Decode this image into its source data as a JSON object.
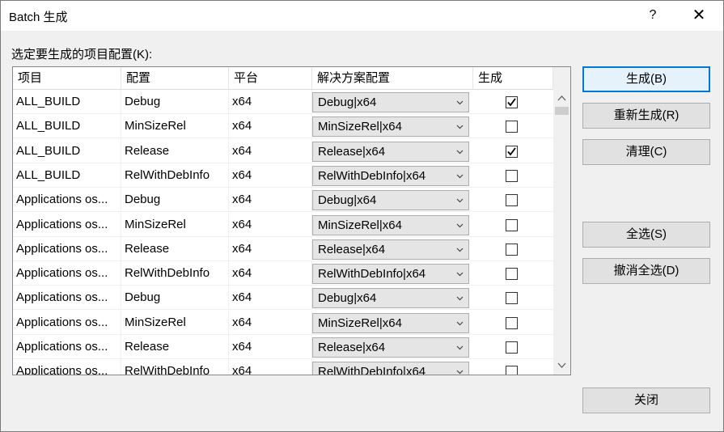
{
  "window": {
    "title": "Batch 生成",
    "help_glyph": "?",
    "close_glyph": "✕"
  },
  "prompt_label": "选定要生成的项目配置(K):",
  "columns": [
    "项目",
    "配置",
    "平台",
    "解决方案配置",
    "生成"
  ],
  "rows": [
    {
      "project": "ALL_BUILD",
      "config": "Debug",
      "platform": "x64",
      "solution_config": "Debug|x64",
      "build": true
    },
    {
      "project": "ALL_BUILD",
      "config": "MinSizeRel",
      "platform": "x64",
      "solution_config": "MinSizeRel|x64",
      "build": false
    },
    {
      "project": "ALL_BUILD",
      "config": "Release",
      "platform": "x64",
      "solution_config": "Release|x64",
      "build": true
    },
    {
      "project": "ALL_BUILD",
      "config": "RelWithDebInfo",
      "platform": "x64",
      "solution_config": "RelWithDebInfo|x64",
      "build": false
    },
    {
      "project": "Applications os...",
      "config": "Debug",
      "platform": "x64",
      "solution_config": "Debug|x64",
      "build": false
    },
    {
      "project": "Applications os...",
      "config": "MinSizeRel",
      "platform": "x64",
      "solution_config": "MinSizeRel|x64",
      "build": false
    },
    {
      "project": "Applications os...",
      "config": "Release",
      "platform": "x64",
      "solution_config": "Release|x64",
      "build": false
    },
    {
      "project": "Applications os...",
      "config": "RelWithDebInfo",
      "platform": "x64",
      "solution_config": "RelWithDebInfo|x64",
      "build": false
    },
    {
      "project": "Applications os...",
      "config": "Debug",
      "platform": "x64",
      "solution_config": "Debug|x64",
      "build": false
    },
    {
      "project": "Applications os...",
      "config": "MinSizeRel",
      "platform": "x64",
      "solution_config": "MinSizeRel|x64",
      "build": false
    },
    {
      "project": "Applications os...",
      "config": "Release",
      "platform": "x64",
      "solution_config": "Release|x64",
      "build": false
    },
    {
      "project": "Applications os...",
      "config": "RelWithDebInfo",
      "platform": "x64",
      "solution_config": "RelWithDebInfo|x64",
      "build": false
    }
  ],
  "buttons": {
    "build": "生成(B)",
    "rebuild": "重新生成(R)",
    "clean": "清理(C)",
    "select_all": "全选(S)",
    "deselect_all": "撤消全选(D)",
    "close": "关闭"
  },
  "colors": {
    "accent": "#0078d7",
    "button_face": "#e1e1e1",
    "dialog_bg": "#f0f0f0"
  }
}
